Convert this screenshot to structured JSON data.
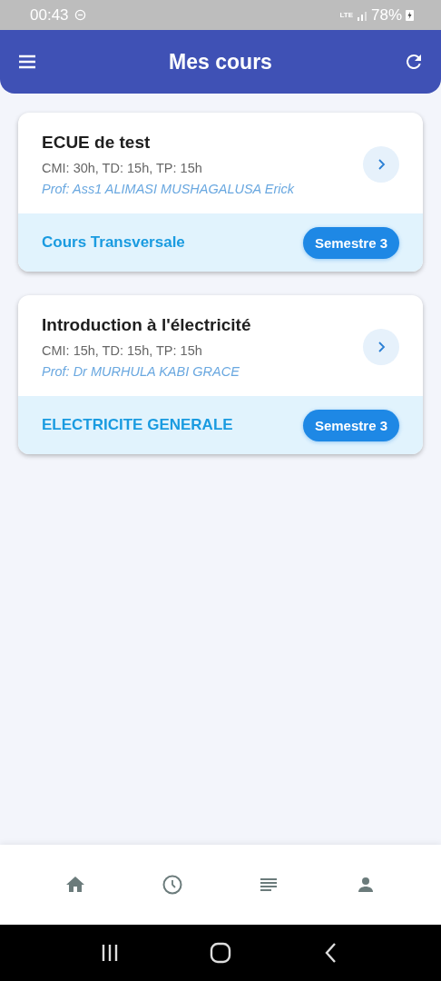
{
  "status_bar": {
    "time": "00:43",
    "network": "LTE",
    "battery": "78%"
  },
  "app_bar": {
    "title": "Mes cours"
  },
  "courses": [
    {
      "title": "ECUE de test",
      "hours": "CMI: 30h, TD: 15h, TP: 15h",
      "teacher": "Prof: Ass1 ALIMASI MUSHAGALUSA Erick",
      "unit": "Cours Transversale",
      "semester": "Semestre 3"
    },
    {
      "title": "Introduction à l'électricité",
      "hours": "CMI: 15h, TD: 15h, TP: 15h",
      "teacher": "Prof: Dr MURHULA KABI GRACE",
      "unit": "ELECTRICITE GENERALE",
      "semester": "Semestre 3"
    }
  ],
  "bottom_nav": [
    {
      "kind": "home"
    },
    {
      "kind": "history"
    },
    {
      "kind": "list"
    },
    {
      "kind": "profile"
    }
  ]
}
